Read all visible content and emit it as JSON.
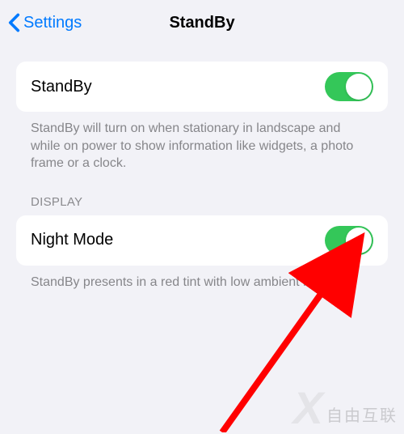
{
  "header": {
    "back_label": "Settings",
    "title": "StandBy"
  },
  "sections": {
    "standby": {
      "toggle_label": "StandBy",
      "toggle_on": true,
      "footer": "StandBy will turn on when stationary in landscape and while on power to show information like widgets, a photo frame or a clock."
    },
    "display": {
      "header": "DISPLAY",
      "night_mode_label": "Night Mode",
      "night_mode_on": true,
      "footer": "StandBy presents in a red tint with low ambient lighting."
    }
  },
  "colors": {
    "accent_blue": "#007aff",
    "toggle_green": "#34c759",
    "background": "#f2f2f7",
    "arrow_red": "#ff0000"
  },
  "watermark": "自由互联"
}
